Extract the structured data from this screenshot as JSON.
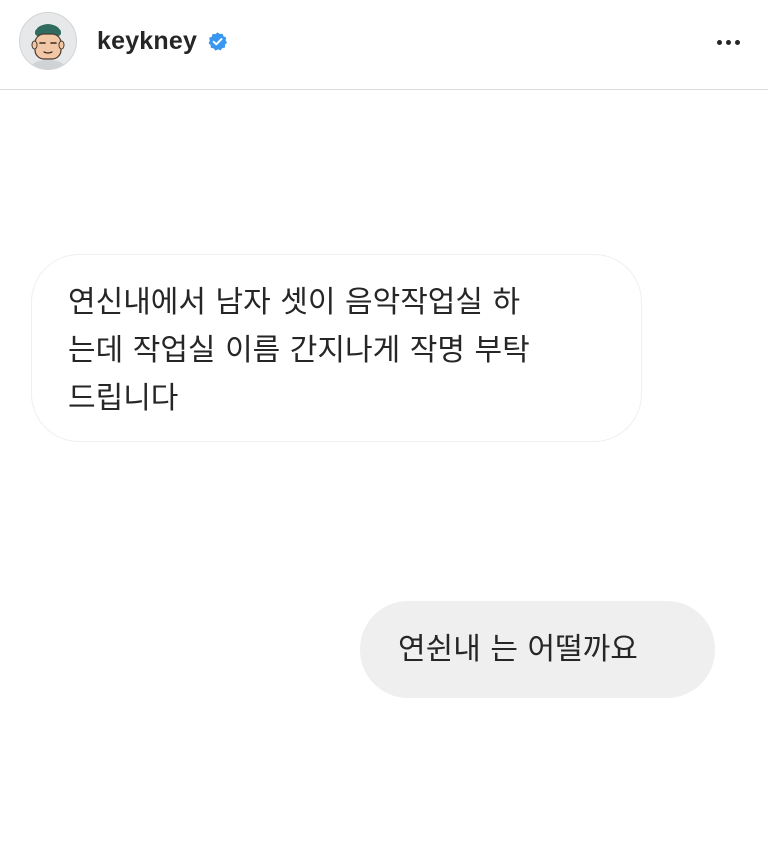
{
  "header": {
    "username": "keykney",
    "verified": true,
    "avatar_icon": "cartoon-face-avatar",
    "more_icon": "more-horizontal-icon"
  },
  "messages": [
    {
      "direction": "received",
      "text": "연신내에서 남자 셋이 음악작업실 하\n는데 작업실 이름 간지나게 작명 부탁\n드립니다"
    },
    {
      "direction": "sent",
      "text": "연쉰내 는 어떨까요"
    }
  ],
  "colors": {
    "verified_badge": "#3897f0",
    "sent_bubble": "#efefef",
    "divider": "#dbdbdb",
    "text": "#262626"
  }
}
